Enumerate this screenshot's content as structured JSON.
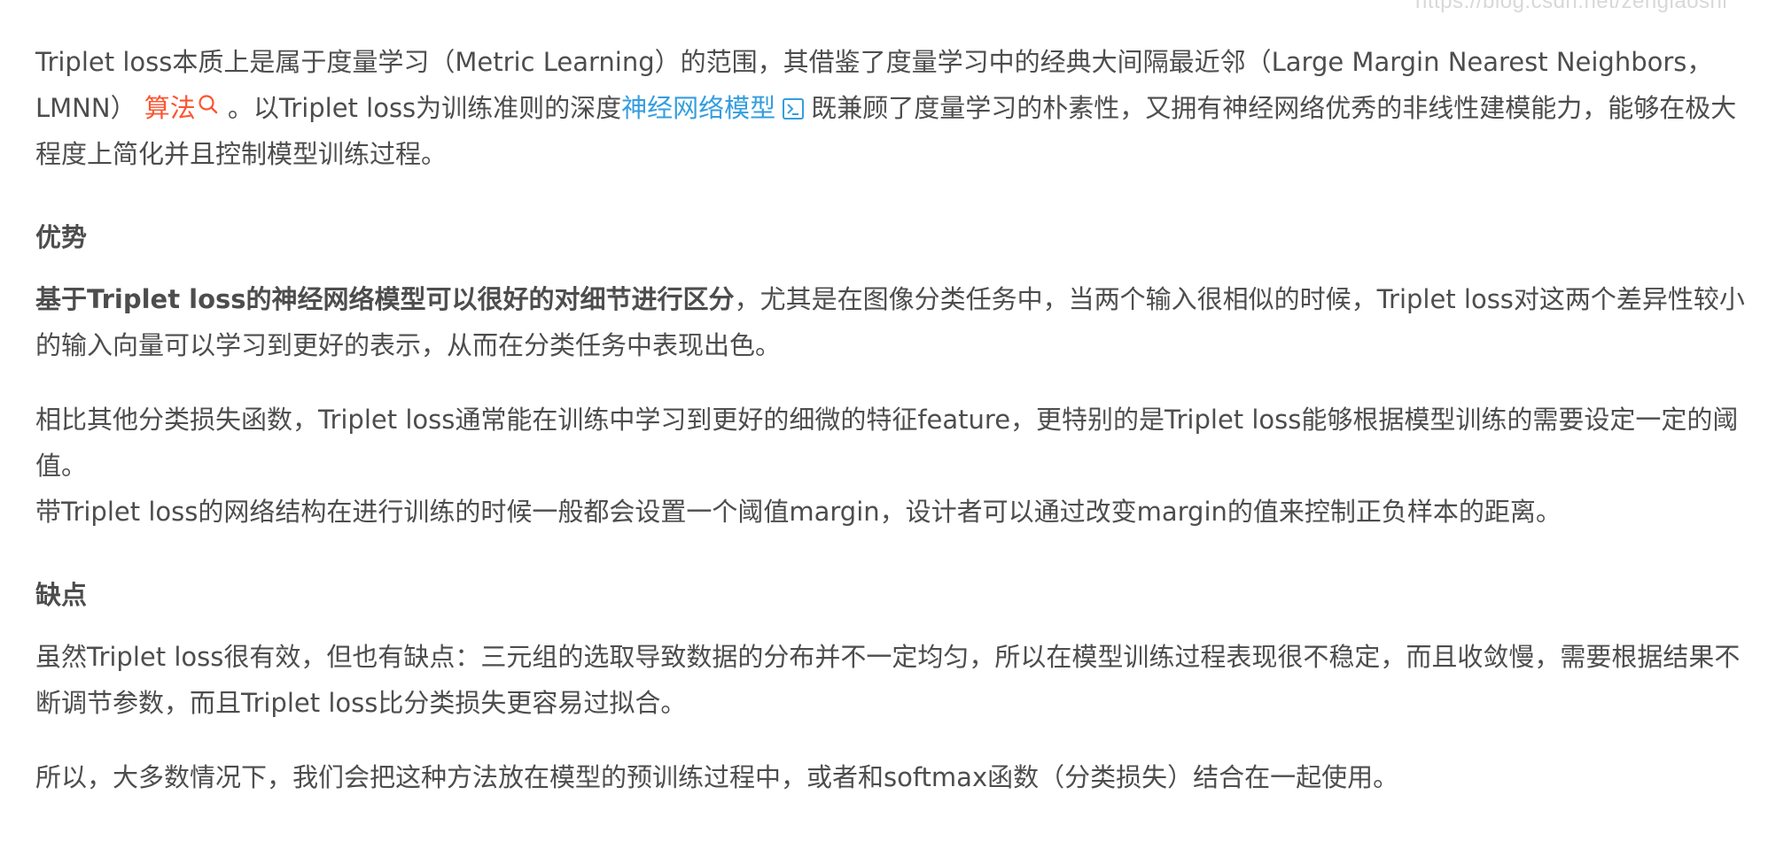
{
  "watermark": "https://blog.csdn.net/zengiaoshi",
  "intro": {
    "part1": "Triplet loss本质上是属于度量学习（Metric Learning）的范围，其借鉴了度量学习中的经典大间隔最近邻（Large Margin Nearest Neighbors，LMNN）",
    "link_algorithm": "算法",
    "part2": "。以Triplet loss为训练准则的深度",
    "link_model": "神经网络模型",
    "part3": "既兼顾了度量学习的朴素性，又拥有神经网络优秀的非线性建模能力，能够在极大程度上简化并且控制模型训练过程。"
  },
  "advantages": {
    "heading": "优势",
    "p1_bold": "基于Triplet loss的神经网络模型可以很好的对细节进行区分",
    "p1_rest": "，尤其是在图像分类任务中，当两个输入很相似的时候，Triplet loss对这两个差异性较小的输入向量可以学习到更好的表示，从而在分类任务中表现出色。",
    "p2": "相比其他分类损失函数，Triplet loss通常能在训练中学习到更好的细微的特征feature，更特别的是Triplet loss能够根据模型训练的需要设定一定的阈值。",
    "p3": "带Triplet loss的网络结构在进行训练的时候一般都会设置一个阈值margin，设计者可以通过改变margin的值来控制正负样本的距离。"
  },
  "disadvantages": {
    "heading": "缺点",
    "p1": "虽然Triplet loss很有效，但也有缺点：三元组的选取导致数据的分布并不一定均匀，所以在模型训练过程表现很不稳定，而且收敛慢，需要根据结果不断调节参数，而且Triplet loss比分类损失更容易过拟合。",
    "p2": "所以，大多数情况下，我们会把这种方法放在模型的预训练过程中，或者和softmax函数（分类损失）结合在一起使用。"
  },
  "colors": {
    "text": "#4d4d4d",
    "link_red": "#fc5531",
    "link_blue": "#349edf",
    "watermark": "#d8d8d8"
  },
  "icons": {
    "search": "search-icon",
    "external": "external-link-icon"
  }
}
